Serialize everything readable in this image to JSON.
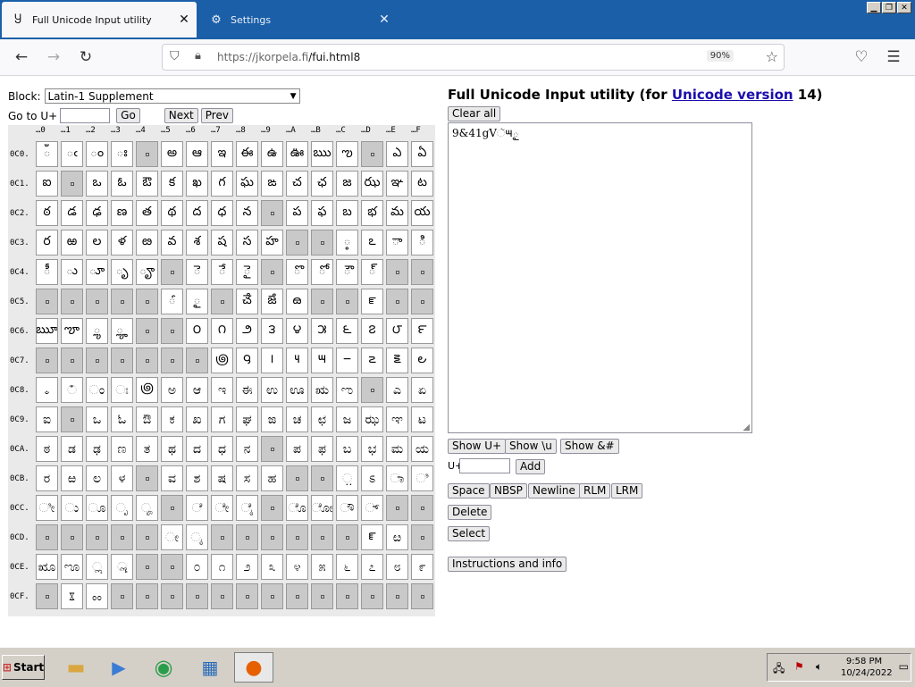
{
  "browser": {
    "tabs": [
      {
        "label": "Full Unicode Input utility",
        "icon": "page-u-icon",
        "active": true
      },
      {
        "label": "Settings",
        "icon": "gear-icon",
        "active": false
      }
    ],
    "url_host": "https://jkorpela.fi",
    "url_path": "/fui.html8",
    "zoom": "90%"
  },
  "block": {
    "label": "Block:",
    "selected": "Latin-1 Supplement"
  },
  "goto": {
    "label": "Go to U+",
    "value": "",
    "go": "Go",
    "next": "Next",
    "prev": "Prev"
  },
  "grid": {
    "columns": [
      "…0",
      "…1",
      "…2",
      "…3",
      "…4",
      "…5",
      "…6",
      "…7",
      "…8",
      "…9",
      "…A",
      "…B",
      "…C",
      "…D",
      "…E",
      "…F"
    ],
    "rows": [
      {
        "code": "0C0.",
        "cells": [
          "ఀ",
          "ఁ",
          "ం",
          "ః",
          "?",
          "అ",
          "ఆ",
          "ఇ",
          "ఈ",
          "ఉ",
          "ఊ",
          "ఋ",
          "ఌ",
          "?",
          "ఎ",
          "ఏ"
        ]
      },
      {
        "code": "0C1.",
        "cells": [
          "ఐ",
          "?",
          "ఒ",
          "ఓ",
          "ఔ",
          "క",
          "ఖ",
          "గ",
          "ఘ",
          "ఙ",
          "చ",
          "ఛ",
          "జ",
          "ఝ",
          "ఞ",
          "ట"
        ]
      },
      {
        "code": "0C2.",
        "cells": [
          "ఠ",
          "డ",
          "ఢ",
          "ణ",
          "త",
          "థ",
          "ద",
          "ధ",
          "న",
          "?",
          "ప",
          "ఫ",
          "బ",
          "భ",
          "మ",
          "య"
        ]
      },
      {
        "code": "0C3.",
        "cells": [
          "ర",
          "ఱ",
          "ల",
          "ళ",
          "ఴ",
          "వ",
          "శ",
          "ష",
          "స",
          "హ",
          "?",
          "?",
          "఼",
          "ఽ",
          "ా",
          "ి"
        ]
      },
      {
        "code": "0C4.",
        "cells": [
          "ీ",
          "ు",
          "ూ",
          "ృ",
          "ౄ",
          "?",
          "ె",
          "ే",
          "ై",
          "?",
          "ొ",
          "ో",
          "ౌ",
          "్",
          "?",
          "?"
        ]
      },
      {
        "code": "0C5.",
        "cells": [
          "?",
          "?",
          "?",
          "?",
          "?",
          "ౕ",
          "ౖ",
          "?",
          "ౘ",
          "ౙ",
          "ౚ",
          "?",
          "?",
          "ౝ",
          "?",
          "?"
        ]
      },
      {
        "code": "0C6.",
        "cells": [
          "ౠ",
          "ౡ",
          "ౢ",
          "ౣ",
          "?",
          "?",
          "౦",
          "౧",
          "౨",
          "౩",
          "౪",
          "౫",
          "౬",
          "౭",
          "౮",
          "౯"
        ]
      },
      {
        "code": "0C7.",
        "cells": [
          "?",
          "?",
          "?",
          "?",
          "?",
          "?",
          "?",
          "౷",
          "౸",
          "౹",
          "౺",
          "౻",
          "౼",
          "౽",
          "౾",
          "౿"
        ]
      },
      {
        "code": "0C8.",
        "cells": [
          "ಀ",
          "ಁ",
          "ಂ",
          "ಃ",
          "಄",
          "ಅ",
          "ಆ",
          "ಇ",
          "ಈ",
          "ಉ",
          "ಊ",
          "ಋ",
          "ಌ",
          "?",
          "ಎ",
          "ಏ"
        ]
      },
      {
        "code": "0C9.",
        "cells": [
          "ಐ",
          "?",
          "ಒ",
          "ಓ",
          "ಔ",
          "ಕ",
          "ಖ",
          "ಗ",
          "ಘ",
          "ಙ",
          "ಚ",
          "ಛ",
          "ಜ",
          "ಝ",
          "ಞ",
          "ಟ"
        ]
      },
      {
        "code": "0CA.",
        "cells": [
          "ಠ",
          "ಡ",
          "ಢ",
          "ಣ",
          "ತ",
          "ಥ",
          "ದ",
          "ಧ",
          "ನ",
          "?",
          "ಪ",
          "ಫ",
          "ಬ",
          "ಭ",
          "ಮ",
          "ಯ"
        ]
      },
      {
        "code": "0CB.",
        "cells": [
          "ರ",
          "ಱ",
          "ಲ",
          "ಳ",
          "?",
          "ವ",
          "ಶ",
          "ಷ",
          "ಸ",
          "ಹ",
          "?",
          "?",
          "಼",
          "ಽ",
          "ಾ",
          "ಿ"
        ]
      },
      {
        "code": "0CC.",
        "cells": [
          "ೀ",
          "ು",
          "ೂ",
          "ೃ",
          "ೄ",
          "?",
          "ೆ",
          "ೇ",
          "ೈ",
          "?",
          "ೊ",
          "ೋ",
          "ೌ",
          "್",
          "?",
          "?"
        ]
      },
      {
        "code": "0CD.",
        "cells": [
          "?",
          "?",
          "?",
          "?",
          "?",
          "ೕ",
          "ೖ",
          "?",
          "?",
          "?",
          "?",
          "?",
          "?",
          "ೝ",
          "ೞ",
          "?"
        ]
      },
      {
        "code": "0CE.",
        "cells": [
          "ೠ",
          "ೡ",
          "ೢ",
          "ೣ",
          "?",
          "?",
          "೦",
          "೧",
          "೨",
          "೩",
          "೪",
          "೫",
          "೬",
          "೭",
          "೮",
          "೯"
        ]
      },
      {
        "code": "0CF.",
        "cells": [
          "?",
          "ೱ",
          "ೲ",
          "?",
          "?",
          "?",
          "?",
          "?",
          "?",
          "?",
          "?",
          "?",
          "?",
          "?",
          "?",
          "?"
        ]
      }
    ]
  },
  "right": {
    "title_pre": "Full Unicode Input utility (for ",
    "title_link": "Unicode version",
    "title_post": " 14)",
    "clear": "Clear all",
    "output": "9&41gVૅ౻ౖ",
    "show_u": "Show U+",
    "show_bs": "Show \\u",
    "show_amp": "Show &#",
    "add_label": "U+",
    "add_value": "",
    "add": "Add",
    "space": "Space",
    "nbsp": "NBSP",
    "newline": "Newline",
    "rlm": "RLM",
    "lrm": "LRM",
    "delete": "Delete",
    "select": "Select",
    "instructions": "Instructions and info"
  },
  "taskbar": {
    "start": "Start",
    "time": "9:58 PM",
    "date": "10/24/2022"
  }
}
